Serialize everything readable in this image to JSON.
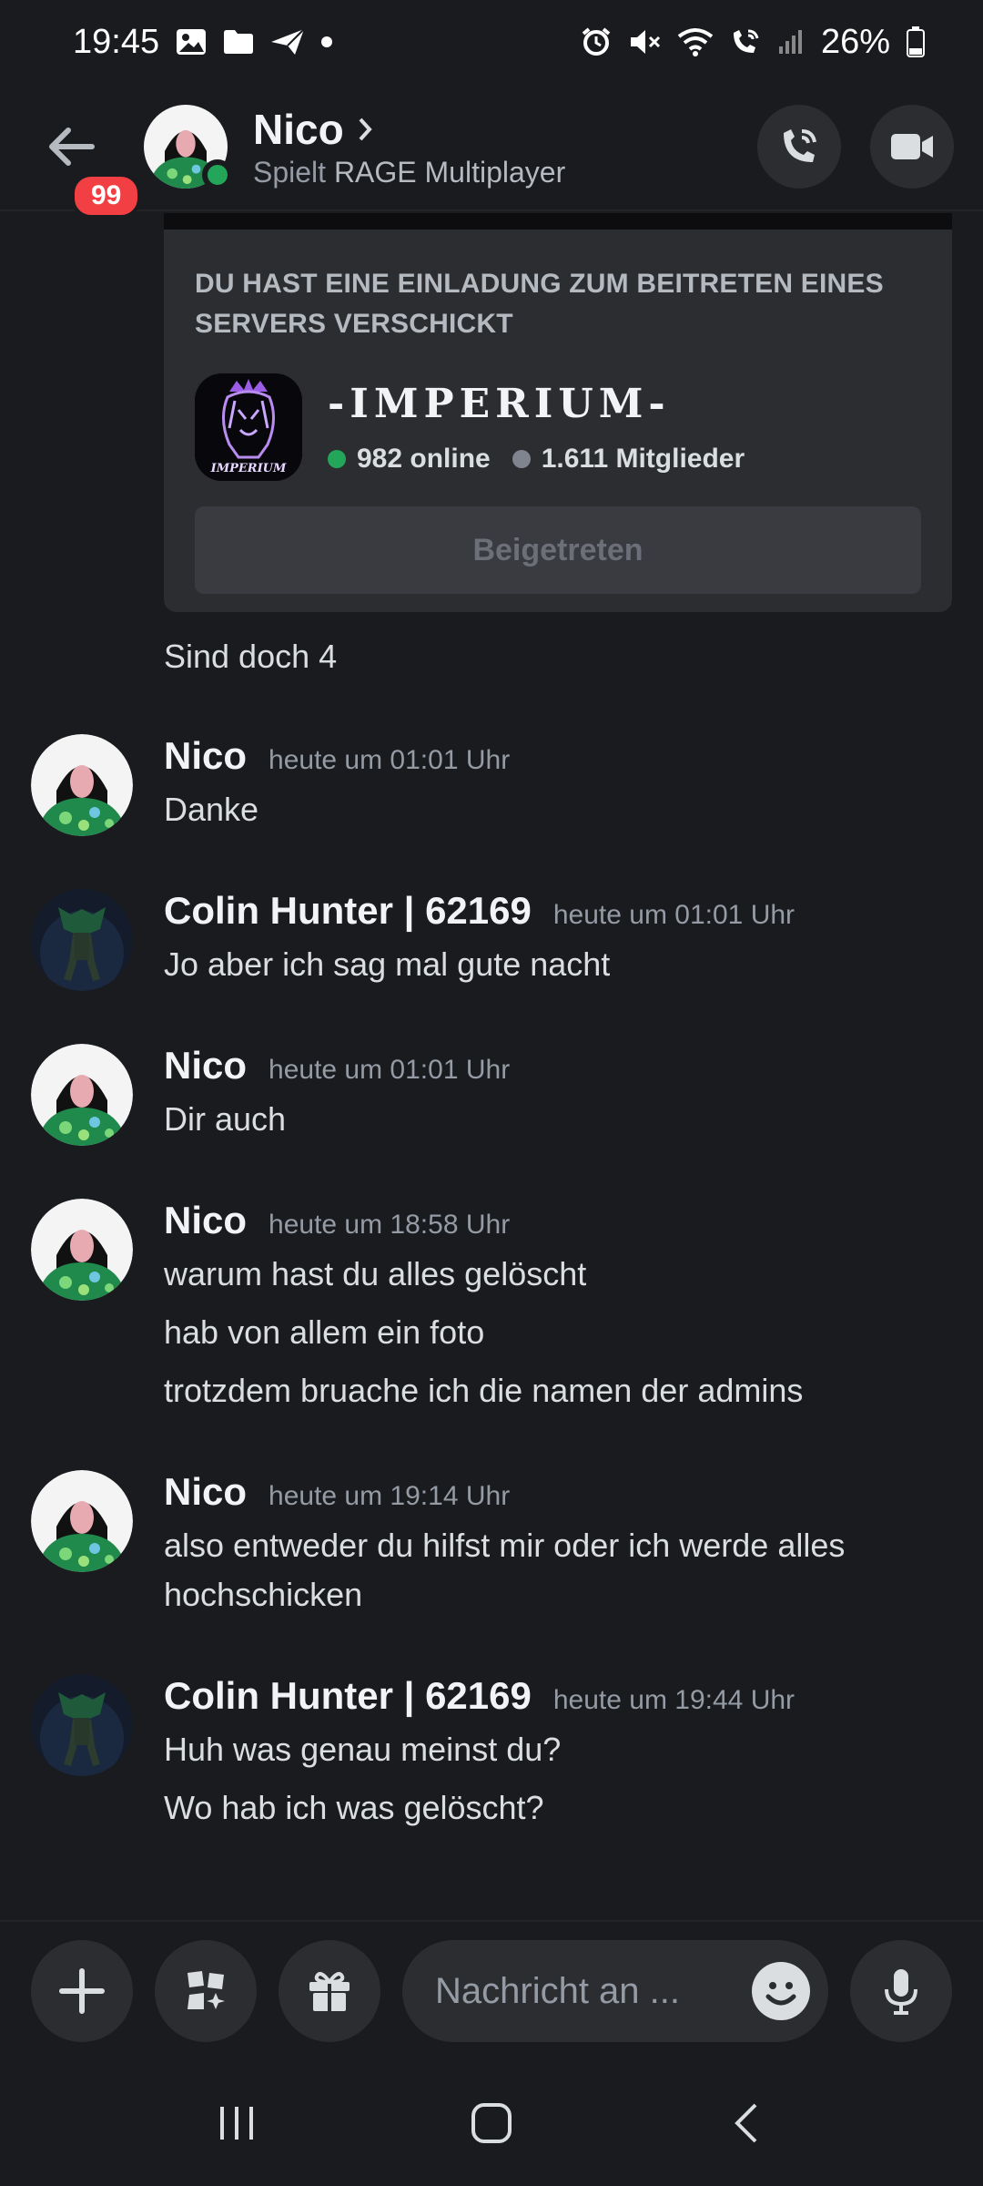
{
  "status_bar": {
    "time": "19:45",
    "battery": "26%"
  },
  "header": {
    "name": "Nico",
    "activity_prefix": "Spielt",
    "activity_game": "RAGE Multiplayer",
    "unread_count": "99"
  },
  "invite": {
    "heading": "DU HAST EINE EINLADUNG ZUM BEITRETEN EINES SERVERS VERSCHICKT",
    "server_name": "-IMPERIUM-",
    "icon_text": "IMPERIUM",
    "online": "982 online",
    "members": "1.611 Mitglieder",
    "button_label": "Beigetreten"
  },
  "continuation": "Sind doch 4",
  "messages": [
    {
      "author": "Nico",
      "time": "heute um 01:01 Uhr",
      "lines": [
        "Danke"
      ]
    },
    {
      "author": "Colin Hunter | 62169",
      "time": "heute um 01:01 Uhr",
      "lines": [
        "Jo aber ich sag mal gute nacht"
      ]
    },
    {
      "author": "Nico",
      "time": "heute um 01:01 Uhr",
      "lines": [
        "Dir auch"
      ]
    },
    {
      "author": "Nico",
      "time": "heute um 18:58 Uhr",
      "lines": [
        "warum hast du alles gelöscht",
        "hab von allem ein foto",
        "trotzdem bruache ich die namen der admins"
      ]
    },
    {
      "author": "Nico",
      "time": "heute um 19:14 Uhr",
      "lines": [
        "also entweder du hilfst mir oder ich werde alles",
        "hochschicken"
      ]
    },
    {
      "author": "Colin Hunter | 62169",
      "time": "heute um 19:44 Uhr",
      "lines": [
        "Huh was genau meinst du?",
        "Wo hab ich was gelöscht?"
      ]
    }
  ],
  "composer": {
    "placeholder": "Nachricht an ..."
  },
  "colors": {
    "background": "#1a1b1f",
    "card": "#2b2d31",
    "online": "#23a55a",
    "badge": "#f23f43"
  }
}
